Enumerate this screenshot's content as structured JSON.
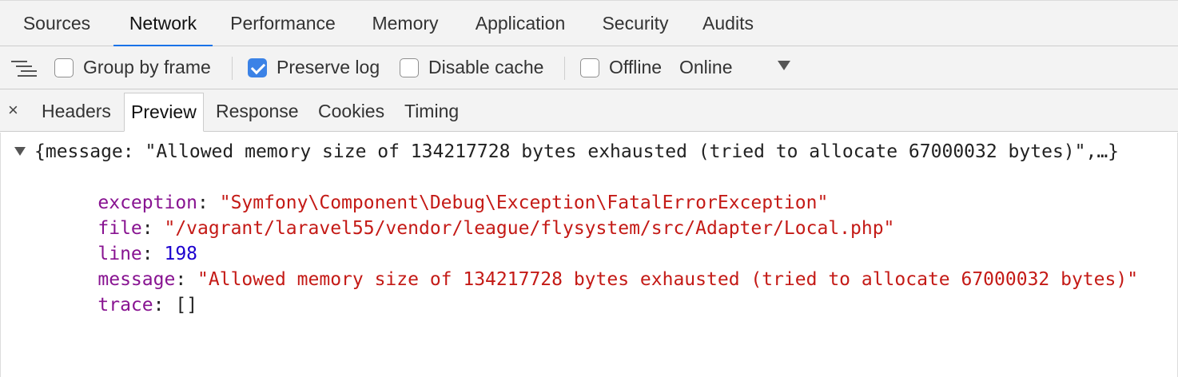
{
  "top_tabs": [
    "Sources",
    "Network",
    "Performance",
    "Memory",
    "Application",
    "Security",
    "Audits"
  ],
  "active_top_tab": "Network",
  "toolbar": {
    "group_by_frame": {
      "label": "Group by frame",
      "checked": false
    },
    "preserve_log": {
      "label": "Preserve log",
      "checked": true
    },
    "disable_cache": {
      "label": "Disable cache",
      "checked": false
    },
    "offline": {
      "label": "Offline",
      "checked": false
    },
    "throttle": "Online"
  },
  "detail_tabs": {
    "close": "×",
    "tabs": [
      "Headers",
      "Preview",
      "Response",
      "Cookies",
      "Timing"
    ],
    "active": "Preview"
  },
  "preview": {
    "summary": "{message: \"Allowed memory size of 134217728 bytes exhausted (tried to allocate 67000032 bytes)\",…}",
    "fields": [
      {
        "key": "exception",
        "value": "\"Symfony\\Component\\Debug\\Exception\\FatalErrorException\"",
        "type": "string"
      },
      {
        "key": "file",
        "value": "\"/vagrant/laravel55/vendor/league/flysystem/src/Adapter/Local.php\"",
        "type": "string"
      },
      {
        "key": "line",
        "value": "198",
        "type": "number"
      },
      {
        "key": "message",
        "value": "\"Allowed memory size of 134217728 bytes exhausted (tried to allocate 67000032 bytes)\"",
        "type": "string"
      },
      {
        "key": "trace",
        "value": "[]",
        "type": "array"
      }
    ]
  },
  "colors": {
    "accent": "#1a73e8",
    "key": "#881391",
    "string": "#c41a16",
    "number": "#1c00cf"
  }
}
